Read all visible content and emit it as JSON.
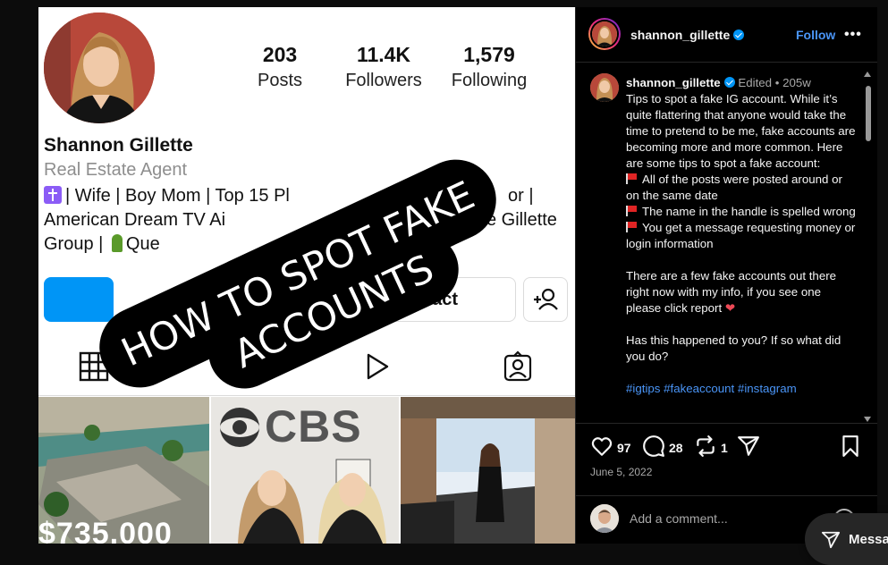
{
  "profile": {
    "posts_count": "203",
    "posts_label": "Posts",
    "followers_count": "11.4K",
    "followers_label": "Followers",
    "following_count": "1,579",
    "following_label": "Following",
    "name": "Shannon Gillette",
    "occupation": "Real Estate Agent",
    "bio_line1": "| Wife | Boy Mom | Top 15 Pl",
    "bio_line1_end": "or |",
    "bio_line2": "American Dream TV Ai",
    "bio_line2_end": "e Gillette",
    "bio_line3": "Group |",
    "bio_line3_end": "Que",
    "contact_label": "ontact",
    "grid_price": "$735,000",
    "grid_brand": "CBS"
  },
  "overlay": {
    "line1": "HOW TO SPOT FAKE",
    "line2": "ACCOUNTS"
  },
  "header": {
    "username": "shannon_gillette",
    "follow_label": "Follow",
    "more_label": "•••"
  },
  "caption": {
    "username": "shannon_gillette",
    "edited": "Edited",
    "dot": "•",
    "age": "205w",
    "intro": "Tips to spot a fake IG account. While it’s quite flattering that anyone would take the time to pretend to be me, fake accounts are becoming more and more common. Here are some tips to spot a fake account:",
    "tip1": "All of the posts were posted around or on the same date",
    "tip2": "The name in the handle is spelled wrong",
    "tip3": "You get a message requesting money or login information",
    "para2": "There are a few fake accounts out there right now with my info, if you see one please click report",
    "heart": "❤",
    "para3": "Has this happened to you? If so what did you do?",
    "hashtags": "#igtips #fakeaccount #instagram"
  },
  "actions": {
    "likes": "97",
    "comments": "28",
    "reposts": "1",
    "date": "June 5, 2022"
  },
  "comment_box": {
    "placeholder": "Add a comment..."
  },
  "messages": {
    "label": "Messa"
  }
}
